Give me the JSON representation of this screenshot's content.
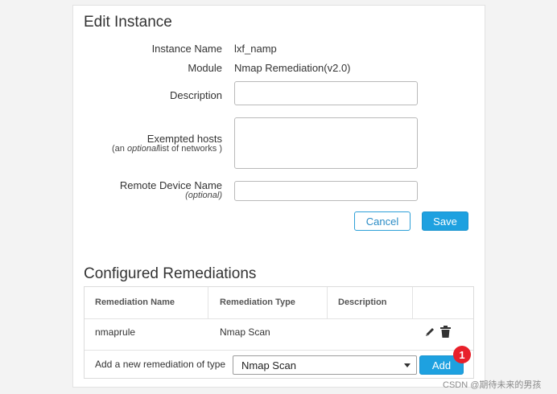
{
  "edit": {
    "title": "Edit Instance",
    "instance_name_label": "Instance Name",
    "instance_name_value": "lxf_namp",
    "module_label": "Module",
    "module_value": "Nmap Remediation(v2.0)",
    "description_label": "Description",
    "description_value": "",
    "exempted_label": "Exempted hosts",
    "exempted_hint_pre": "(an ",
    "exempted_hint_em": "optional",
    "exempted_hint_post": "list of networks )",
    "exempted_value": "",
    "remote_label": "Remote Device Name",
    "remote_hint": "(optional)",
    "remote_value": "",
    "cancel_label": "Cancel",
    "save_label": "Save"
  },
  "remediations": {
    "title": "Configured Remediations",
    "columns": [
      "Remediation Name",
      "Remediation Type",
      "Description"
    ],
    "rows": [
      {
        "name": "nmaprule",
        "type": "Nmap Scan",
        "description": ""
      }
    ],
    "add_label": "Add a new remediation of type",
    "add_select_value": "Nmap Scan",
    "add_button_label": "Add",
    "badge": "1",
    "row_icons": [
      "pencil-icon",
      "trash-icon"
    ]
  },
  "watermark": "CSDN @期待未来的男孩"
}
